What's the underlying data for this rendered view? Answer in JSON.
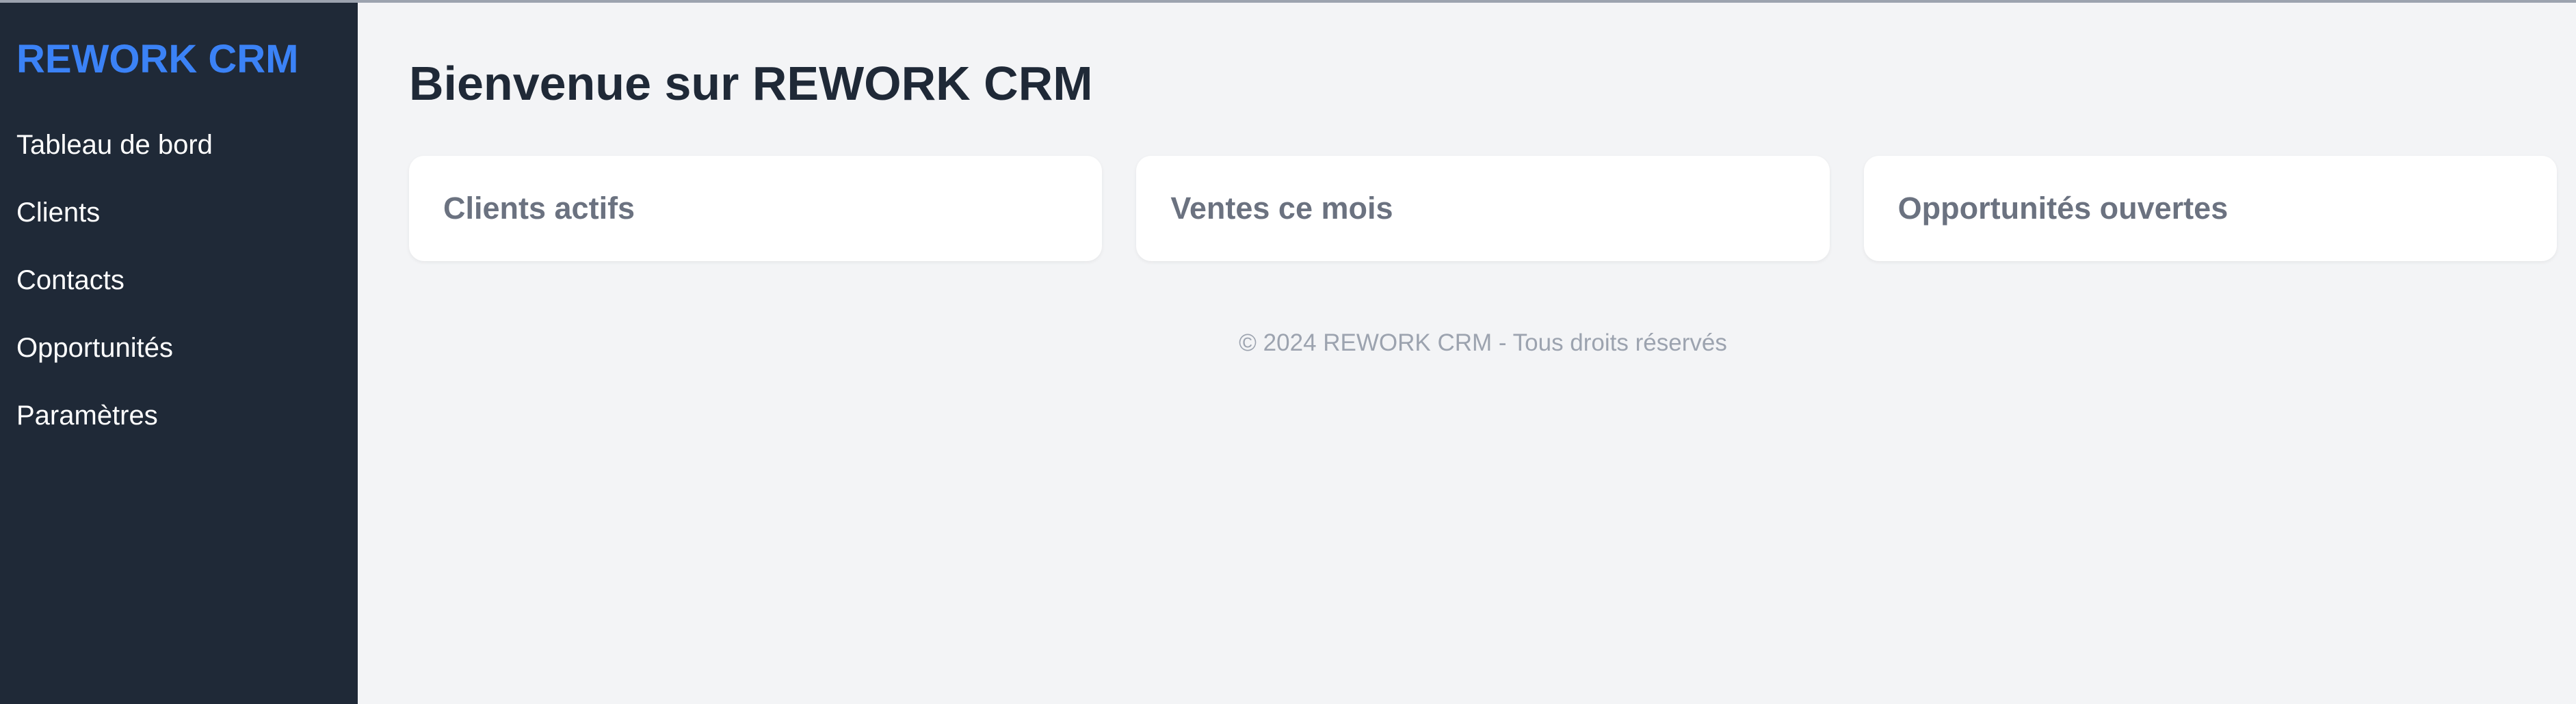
{
  "sidebar": {
    "brand": "REWORK CRM",
    "items": [
      {
        "label": "Tableau de bord"
      },
      {
        "label": "Clients"
      },
      {
        "label": "Contacts"
      },
      {
        "label": "Opportunités"
      },
      {
        "label": "Paramètres"
      }
    ]
  },
  "main": {
    "title": "Bienvenue sur REWORK CRM",
    "cards": [
      {
        "title": "Clients actifs"
      },
      {
        "title": "Ventes ce mois"
      },
      {
        "title": "Opportunités ouvertes"
      }
    ],
    "footer": "© 2024 REWORK CRM - Tous droits réservés"
  },
  "colors": {
    "sidebar_bg": "#1f2937",
    "brand": "#3b82f6",
    "page_bg": "#f3f4f6",
    "card_bg": "#ffffff",
    "title_text": "#1f2937",
    "card_text": "#6b7280",
    "footer_text": "#9ca3af"
  }
}
